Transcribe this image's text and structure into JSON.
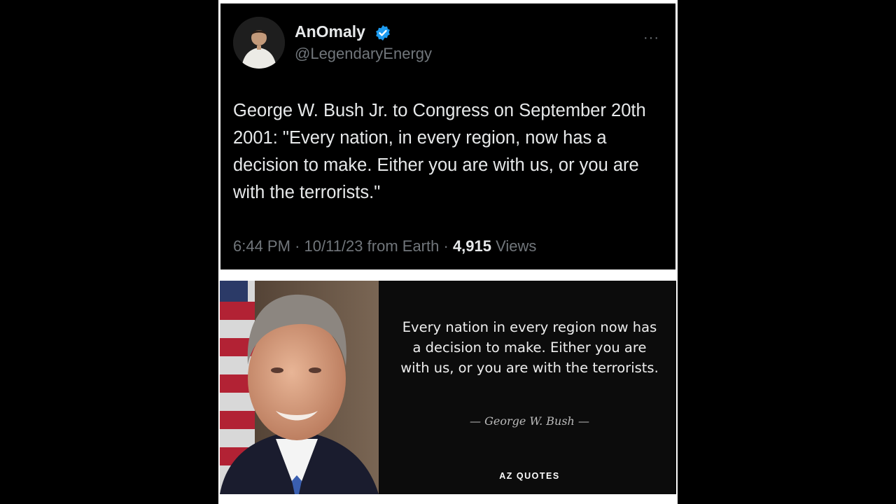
{
  "tweet": {
    "author_name": "AnOmaly",
    "author_handle": "@LegendaryEnergy",
    "text": "George W. Bush Jr. to Congress on September 20th 2001: \"Every nation, in every region, now has a decision to make. Either you are with us, or you are with the terrorists.\"",
    "time": "6:44 PM",
    "date": "10/11/23",
    "source": "from Earth",
    "separator": "·",
    "views_count": "4,915",
    "views_label": "Views",
    "more_icon": "···",
    "verified_color": "#1d9bf0"
  },
  "quote_card": {
    "text": "Every nation in every region now has a decision to make. Either you are with us, or you are with the terrorists.",
    "author": "— George W. Bush —",
    "brand": "AZ QUOTES"
  }
}
